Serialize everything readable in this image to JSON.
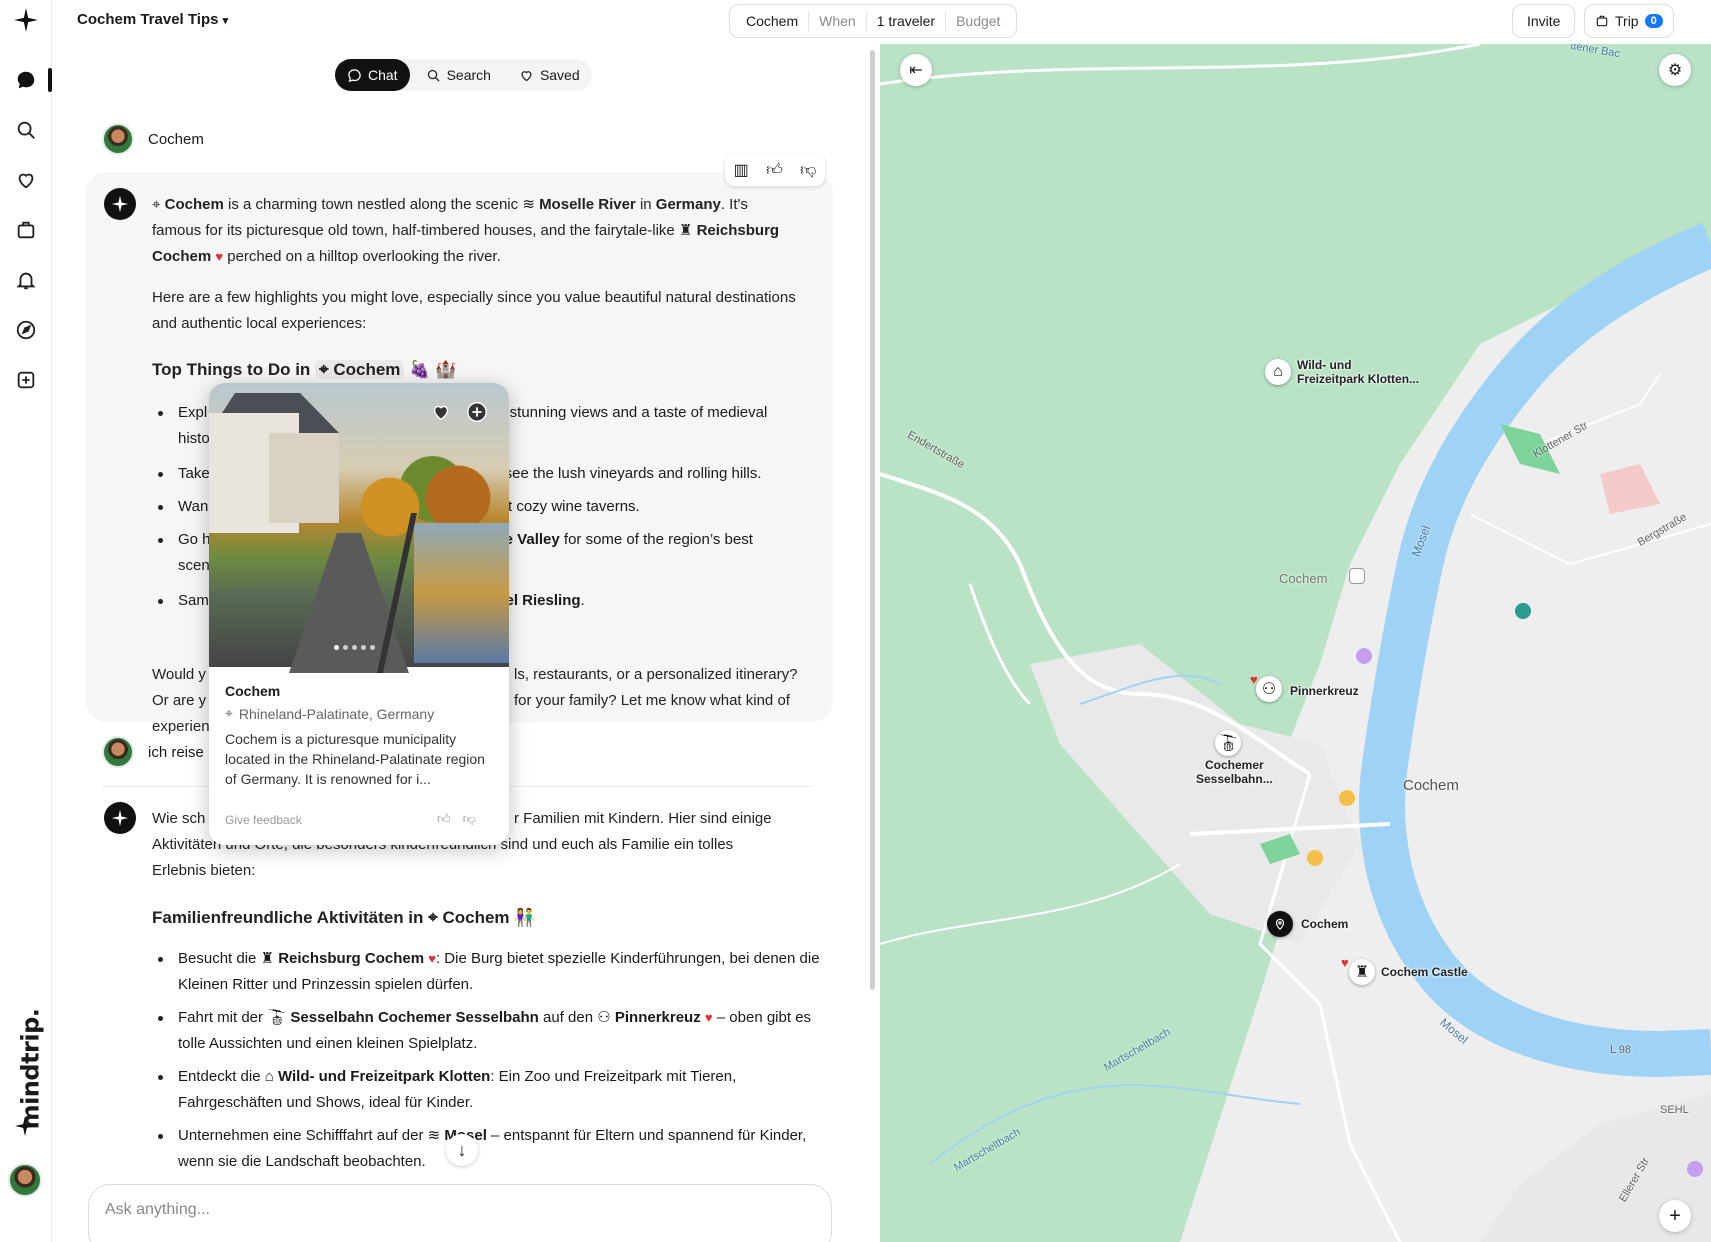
{
  "topbar": {
    "title": "Cochem Travel Tips",
    "filters": [
      "Cochem",
      "When",
      "1 traveler",
      "Budget"
    ],
    "invite_label": "Invite",
    "trip_label": "Trip",
    "trip_count": "0"
  },
  "tabs": {
    "chat": "Chat",
    "search": "Search",
    "saved": "Saved"
  },
  "brand": "mindtrip.",
  "conversation": {
    "user1": "Cochem",
    "ai1": {
      "p1_a": "Cochem",
      "p1_b": " is a charming town nestled along the scenic ",
      "p1_c": "Moselle River",
      "p1_d": " in ",
      "p1_e": "Germany",
      "p1_f": ". It's famous for its picturesque old town, half-timbered houses, and the fairytale-like ",
      "p1_g": "Reichsburg Cochem",
      "p1_h": " perched on a hilltop overlooking the river.",
      "p2": "Here are a few highlights you might love, especially since you value beautiful natural destinations and authentic local experiences:",
      "h_a": "Top Things to Do in",
      "h_b": "Cochem",
      "bullets": [
        {
          "a": "Expl",
          "b": "for stunning views and a taste of medieval",
          "c": "histo"
        },
        {
          "a": "Take",
          "b": "to see the lush vineyards and rolling hills."
        },
        {
          "a": "Wan",
          "b": "s at cozy wine taverns."
        },
        {
          "a": "Go h",
          "b": "elle Valley",
          "c": " for some of the region’s best",
          "d": "scen"
        },
        {
          "a": "Sam",
          "b": "osel Riesling",
          "c": "."
        }
      ],
      "p3_a": "Would y",
      "p3_b": "ls, restaurants, or a personalized itinerary?",
      "p3_c": "Or are y",
      "p3_d": "for your family? Let me know what kind of",
      "p3_e": "experien"
    },
    "user2": "ich reise",
    "ai2": {
      "p1_a": "Wie sch",
      "p1_b": "r Familien mit Kindern. Hier sind einige",
      "p1_c": "Aktivitäten und Orte, die besonders kinderfreundlich sind und euch als Familie ein tolles",
      "p1_d": "Erlebnis bieten:",
      "h_a": "Familienfreundliche Aktivitäten in",
      "h_b": "Cochem",
      "bullets": [
        {
          "a": "Besucht die ",
          "b": "Reichsburg Cochem",
          "c": ": Die Burg bietet spezielle Kinderführungen, bei denen die Kleinen Ritter und Prinzessin spielen dürfen."
        },
        {
          "a": "Fahrt mit der ",
          "b": "Sesselbahn Cochemer Sesselbahn",
          "c": " auf den ",
          "d": "Pinnerkreuz",
          "e": " – oben gibt es tolle Aussichten und einen kleinen Spielplatz."
        },
        {
          "a": "Entdeckt die ",
          "b": "Wild- und Freizeitpark Klotten",
          "c": ": Ein Zoo und Freizeitpark mit Tieren, Fahrgeschäften und Shows, ideal für Kinder."
        },
        {
          "a": "Unternehmen eine Schifffahrt auf der ",
          "b": "Mosel",
          "c": " – entspannt für Eltern und spannend für Kinder, wenn sie die Landschaft beobachten."
        }
      ]
    }
  },
  "popup": {
    "name": "Cochem",
    "location": "Rhineland-Palatinate, Germany",
    "description": "Cochem is a picturesque municipality located in the Rhineland-Palatinate region of Germany. It is renowned for i...",
    "feedback": "Give feedback"
  },
  "composer": {
    "placeholder": "Ask anything..."
  },
  "map": {
    "pois": {
      "wild": "Wild- und\nFreizeitpark Klotten...",
      "pinnerkreuz": "Pinnerkreuz",
      "sesselbahn": "Cochemer\nSesselbahn...",
      "cochem": "Cochem",
      "castle": "Cochem Castle",
      "station": "Cochem"
    },
    "places": {
      "town": "Cochem",
      "river1": "Mosel",
      "river2": "Mosel",
      "road1": "Endertstraße",
      "road2": "Klottener Str",
      "road3": "Bergstraße",
      "stream1": "Martscheltbach",
      "stream2": "Martscheltbach",
      "road4": "L 98",
      "road5": "Ellerer Str",
      "sehl": "SEHL",
      "top": "ttener Bac"
    }
  },
  "colors": {
    "accent": "#1677ff",
    "river": "#9fd3f5",
    "green": "#b9e3c4",
    "heart": "#e03131"
  }
}
